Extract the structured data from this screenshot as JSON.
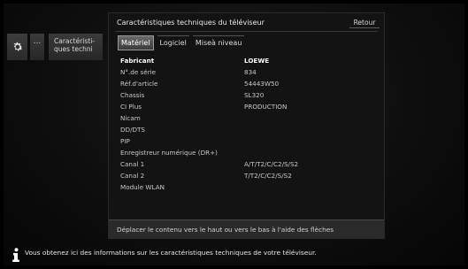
{
  "side_menu": {
    "dots_label": "...",
    "item_label": "Caractéristi­ques techni"
  },
  "dialog": {
    "title": "Caractéristiques techniques du téléviseur",
    "back_label": "Retour",
    "tabs": [
      {
        "label": "Matériel",
        "active": true
      },
      {
        "label": "Logiciel",
        "active": false
      },
      {
        "label": "Miseà niveau",
        "active": false
      }
    ],
    "rows": [
      {
        "key": "Fabricant",
        "value": "LOEWE"
      },
      {
        "key": "N°.de série",
        "value": "834"
      },
      {
        "key": "Réf.d'article",
        "value": "54443W50"
      },
      {
        "key": "Chassis",
        "value": "SL320"
      },
      {
        "key": "CI Plus",
        "value": "PRODUCTION"
      },
      {
        "key": "Nicam",
        "value": ""
      },
      {
        "key": "DD/DTS",
        "value": ""
      },
      {
        "key": "PIP",
        "value": ""
      },
      {
        "key": "Enregistreur numérique (DR+)",
        "value": ""
      },
      {
        "key": "Canal 1",
        "value": "A/T/T2/C/C2/S/S2"
      },
      {
        "key": "Canal 2",
        "value": "T/T2/C/C2/S/S2"
      },
      {
        "key": "Module WLAN",
        "value": ""
      }
    ],
    "hint": "Déplacer le contenu vers le haut ou vers le bas à l'aide des flèches"
  },
  "info_bar": {
    "text": "Vous obtenez ici des informations sur les caractéristiques techniques de votre téléviseur."
  }
}
